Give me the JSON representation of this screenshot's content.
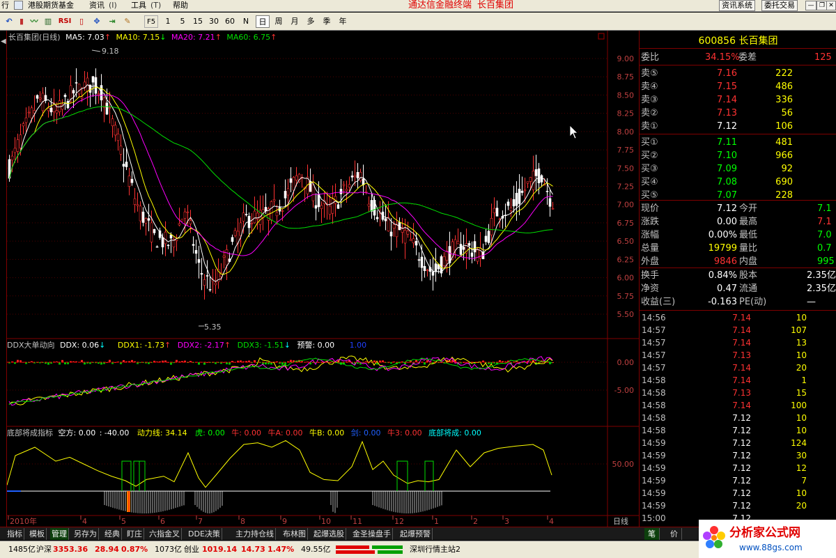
{
  "menu": {
    "items": [
      "行",
      "港股期货基金",
      "资讯",
      "工具",
      "帮助"
    ],
    "title": "通达信金融终端",
    "stock_name": "长百集团",
    "sys_buttons": [
      "资讯系统",
      "委托交易"
    ]
  },
  "toolbar": {
    "indicators": [
      "RSI",
      "F5"
    ],
    "periods": [
      "1",
      "5",
      "15",
      "30",
      "60",
      "N",
      "日",
      "周",
      "月",
      "多",
      "季",
      "年"
    ],
    "active_period": "日"
  },
  "main_chart": {
    "legend": {
      "name": "长百集团(日线)",
      "ma5": "MA5: 7.03",
      "ma10": "MA10: 7.15",
      "ma20": "MA20: 7.21",
      "ma60": "MA60: 6.75"
    },
    "price_ticks": [
      "9.00",
      "8.75",
      "8.50",
      "8.25",
      "8.00",
      "7.75",
      "7.50",
      "7.25",
      "7.00",
      "6.75",
      "6.50",
      "6.25",
      "6.00",
      "5.75",
      "5.50"
    ],
    "high_label": "9.18",
    "low_label": "5.35",
    "colors": {
      "up": "#ff3232",
      "down": "#ffffff",
      "ma5": "#ffffff",
      "ma10": "#ffff00",
      "ma20": "#ff00ff",
      "ma60": "#00e000"
    }
  },
  "ddx_panel": {
    "legend": {
      "name": "DDX大单动向",
      "ddx": "DDX: 0.06",
      "ddx1": "DDX1: -1.73",
      "ddx2": "DDX2: -2.17",
      "ddx3": "DDX3: -1.51",
      "warn": "预警: 0.00",
      "last": "1.00"
    },
    "ticks": [
      "0.00",
      "-5.00"
    ]
  },
  "bottom_panel": {
    "legend": {
      "name": "底部将成指标",
      "kongfang": "空方: 0.00",
      "neg": ": -40.00",
      "dongli": "动力线: 34.14",
      "hu": "虎: 0.00",
      "niu": "牛: 0.00",
      "niua": "牛A: 0.00",
      "niub": "牛B: 0.00",
      "jian": "剑: 0.00",
      "niu3": "牛3: 0.00",
      "dibu": "底部将成: 0.00"
    },
    "ticks": [
      "50.00"
    ]
  },
  "date_axis": {
    "labels": [
      "2010年",
      "4",
      "5",
      "6",
      "7",
      "8",
      "9",
      "10",
      "11",
      "12",
      "1",
      "2",
      "3",
      "4"
    ],
    "period_label": "日线"
  },
  "quote": {
    "code": "600856",
    "name": "长百集团",
    "weibi_label": "委比",
    "weibi": "34.15%",
    "weicha_label": "委差",
    "weicha": "125",
    "asks": [
      {
        "label": "卖⑤",
        "price": "7.16",
        "vol": "222"
      },
      {
        "label": "卖④",
        "price": "7.15",
        "vol": "486"
      },
      {
        "label": "卖③",
        "price": "7.14",
        "vol": "336"
      },
      {
        "label": "卖②",
        "price": "7.13",
        "vol": "56"
      },
      {
        "label": "卖①",
        "price": "7.12",
        "vol": "106"
      }
    ],
    "bids": [
      {
        "label": "买①",
        "price": "7.11",
        "vol": "481"
      },
      {
        "label": "买②",
        "price": "7.10",
        "vol": "966"
      },
      {
        "label": "买③",
        "price": "7.09",
        "vol": "92"
      },
      {
        "label": "买④",
        "price": "7.08",
        "vol": "690"
      },
      {
        "label": "买⑤",
        "price": "7.07",
        "vol": "228"
      }
    ],
    "stats": [
      {
        "l1": "现价",
        "v1": "7.12",
        "l2": "今开",
        "v2": "7.1",
        "c1": "#ffffff",
        "c2": "#00ff00"
      },
      {
        "l1": "涨跌",
        "v1": "0.00",
        "l2": "最高",
        "v2": "7.1",
        "c1": "#ffffff",
        "c2": "#ff3232"
      },
      {
        "l1": "涨幅",
        "v1": "0.00%",
        "l2": "最低",
        "v2": "7.0",
        "c1": "#ffffff",
        "c2": "#00ff00"
      },
      {
        "l1": "总量",
        "v1": "19799",
        "l2": "量比",
        "v2": "0.7",
        "c1": "#ffff00",
        "c2": "#00ff00"
      },
      {
        "l1": "外盘",
        "v1": "9846",
        "l2": "内盘",
        "v2": "995",
        "c1": "#ff3232",
        "c2": "#00ff00"
      }
    ],
    "stats2": [
      {
        "l1": "换手",
        "v1": "0.84%",
        "l2": "股本",
        "v2": "2.35亿"
      },
      {
        "l1": "净资",
        "v1": "0.47",
        "l2": "流通",
        "v2": "2.35亿"
      },
      {
        "l1": "收益(三)",
        "v1": "-0.163",
        "l2": "PE(动)",
        "v2": "—"
      }
    ],
    "ticks": [
      {
        "t": "14:56",
        "p": "7.14",
        "v": "10",
        "c": "#ff3232"
      },
      {
        "t": "14:57",
        "p": "7.14",
        "v": "107",
        "c": "#ff3232"
      },
      {
        "t": "14:57",
        "p": "7.14",
        "v": "13",
        "c": "#ff3232"
      },
      {
        "t": "14:57",
        "p": "7.13",
        "v": "10",
        "c": "#ff3232"
      },
      {
        "t": "14:57",
        "p": "7.14",
        "v": "20",
        "c": "#ff3232"
      },
      {
        "t": "14:58",
        "p": "7.14",
        "v": "1",
        "c": "#ff3232"
      },
      {
        "t": "14:58",
        "p": "7.13",
        "v": "15",
        "c": "#ff3232"
      },
      {
        "t": "14:58",
        "p": "7.14",
        "v": "100",
        "c": "#ff3232"
      },
      {
        "t": "14:58",
        "p": "7.12",
        "v": "10",
        "c": "#ffffff"
      },
      {
        "t": "14:58",
        "p": "7.12",
        "v": "10",
        "c": "#ffffff"
      },
      {
        "t": "14:59",
        "p": "7.12",
        "v": "124",
        "c": "#ffffff"
      },
      {
        "t": "14:59",
        "p": "7.12",
        "v": "30",
        "c": "#ffffff"
      },
      {
        "t": "14:59",
        "p": "7.12",
        "v": "12",
        "c": "#ffffff"
      },
      {
        "t": "14:59",
        "p": "7.12",
        "v": "7",
        "c": "#ffffff"
      },
      {
        "t": "14:59",
        "p": "7.12",
        "v": "10",
        "c": "#ffffff"
      },
      {
        "t": "14:59",
        "p": "7.12",
        "v": "20",
        "c": "#ffffff"
      },
      {
        "t": "15:00",
        "p": "7.12",
        "v": "",
        "c": "#ffffff"
      }
    ]
  },
  "bottom_tabs": [
    "指标",
    "模板",
    "管理",
    "另存为",
    "经典",
    "盯庄",
    "六指金叉",
    "DDE决策",
    "主力持仓线",
    "布林图",
    "起爆选股",
    "金圣操盘手",
    "起爆预警"
  ],
  "active_tab": "管理",
  "right_tabs": [
    "笔",
    "价"
  ],
  "status": {
    "vol1": "1485亿",
    "hu_label": "沪深",
    "hu_index": "3353.36",
    "hu_chg": "28.94",
    "hu_pct": "0.87%",
    "vol2": "1073亿",
    "cy_label": "创业",
    "cy_index": "1019.14",
    "cy_chg": "14.73",
    "cy_pct": "1.47%",
    "vol3": "49.55亿",
    "server": "深圳行情主站2"
  },
  "watermark": {
    "text": "分析家公式网",
    "url": "www.88gs.com"
  }
}
